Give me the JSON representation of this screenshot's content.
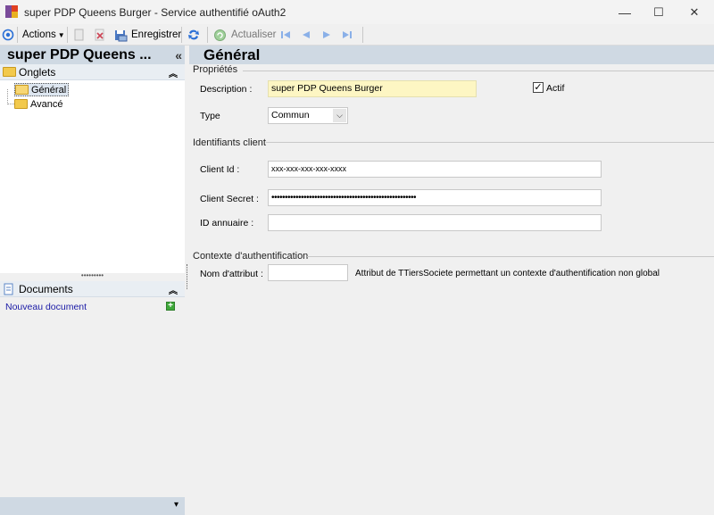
{
  "window": {
    "title": "super PDP Queens Burger -  Service authentifié oAuth2",
    "minimize": "—",
    "maximize": "☐",
    "close": "✕"
  },
  "toolbar": {
    "actions_label": "Actions",
    "save_label": "Enregistrer",
    "refresh_label": "Actualiser"
  },
  "left": {
    "title": "super PDP Queens ...",
    "collapse_glyph": "«",
    "tabs_section": "Onglets",
    "tree": [
      {
        "label": "Général"
      },
      {
        "label": "Avancé"
      }
    ],
    "splitter_glyph": "•••••••••",
    "documents_section": "Documents",
    "new_document": "Nouveau document",
    "chevron_up": "⌃",
    "footer_glyph": "▾"
  },
  "main": {
    "title": "Général",
    "proprietes": {
      "title": "Propriétés",
      "description_label": "Description :",
      "description_value": "super PDP Queens Burger",
      "actif_label": "Actif",
      "actif_checked": true,
      "type_label": "Type",
      "type_value": "Commun"
    },
    "identifiants": {
      "title": "Identifiants client",
      "client_id_label": "Client Id :",
      "client_id_value": "xxx-xxx-xxx-xxx-xxxx",
      "client_secret_label": "Client Secret :",
      "client_secret_value": "••••••••••••••••••••••••••••••••••••••••••••••••••••••",
      "id_annuaire_label": "ID annuaire :",
      "id_annuaire_value": ""
    },
    "contexte": {
      "title": "Contexte d'authentification",
      "nom_attribut_label": "Nom d'attribut :",
      "nom_attribut_value": "",
      "description": "Attribut de TTiersSociete permettant un contexte d'authentification non global"
    }
  },
  "colors": {
    "header_bg": "#cfd9e3",
    "highlight_input": "#fdf6c3",
    "link": "#1a1aa6",
    "nav_blue": "#4a7fd0"
  }
}
